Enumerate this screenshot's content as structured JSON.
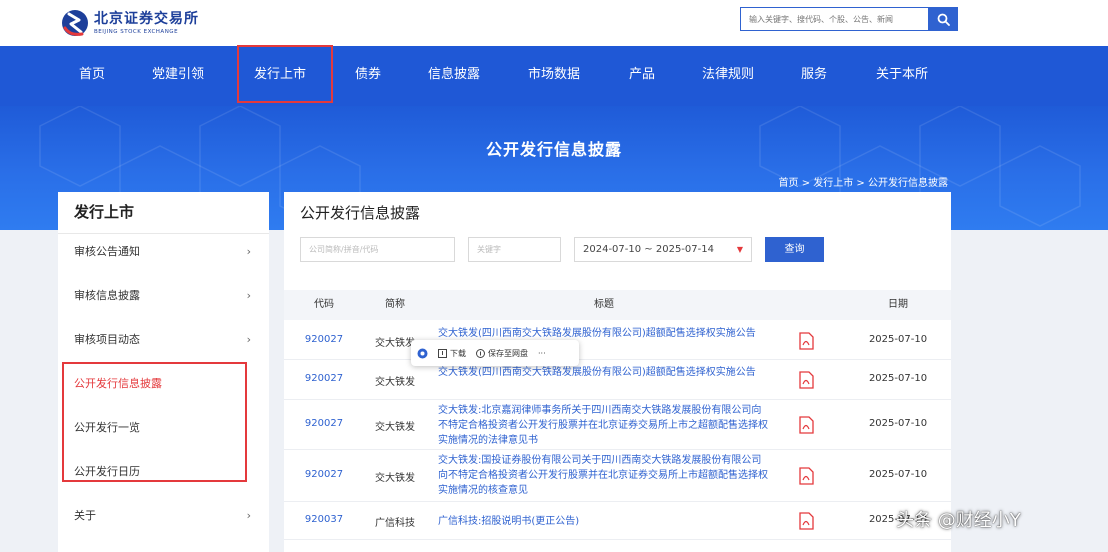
{
  "header": {
    "logo_cn": "北京证券交易所",
    "logo_en": "BEIJING STOCK EXCHANGE",
    "search_placeholder": "输入关键字、搜代码、个股、公告、新闻",
    "colors": {
      "brand": "#1f58d6",
      "accent_red": "#e4393c"
    }
  },
  "nav": {
    "items": [
      "首页",
      "党建引领",
      "发行上市",
      "债券",
      "信息披露",
      "市场数据",
      "产品",
      "法律规则",
      "服务",
      "关于本所"
    ],
    "highlighted": "发行上市"
  },
  "banner": {
    "title": "公开发行信息披露",
    "breadcrumb": "首页 > 发行上市 > 公开发行信息披露"
  },
  "sidebar": {
    "title": "发行上市",
    "items": [
      {
        "label": "审核公告通知",
        "chevron": "›"
      },
      {
        "label": "审核信息披露",
        "chevron": "›"
      },
      {
        "label": "审核项目动态",
        "chevron": "›"
      },
      {
        "label": "公开发行信息披露",
        "chevron": ""
      },
      {
        "label": "公开发行一览",
        "chevron": ""
      },
      {
        "label": "公开发行日历",
        "chevron": ""
      },
      {
        "label": "关于",
        "chevron": "›"
      }
    ]
  },
  "main": {
    "title": "公开发行信息披露",
    "filters": {
      "company_placeholder": "公司简称/拼音/代码",
      "keyword_placeholder": "关键字",
      "date_range": "2024-07-10 ~ 2025-07-14",
      "query_button": "查询"
    },
    "table": {
      "headers": [
        "代码",
        "简称",
        "标题",
        "日期"
      ],
      "rows": [
        {
          "code": "920027",
          "name": "交大铁发",
          "title": "交大铁发(四川西南交大铁路发展股份有限公司)超额配售选择权实施公告",
          "date": "2025-07-10"
        },
        {
          "code": "920027",
          "name": "交大铁发",
          "title": "交大铁发(四川西南交大铁路发展股份有限公司)超额配售选择权实施公告",
          "date": "2025-07-10"
        },
        {
          "code": "920027",
          "name": "交大铁发",
          "title": "交大铁发:北京嘉润律师事务所关于四川西南交大铁路发展股份有限公司向不特定合格投资者公开发行股票并在北京证券交易所上市之超额配售选择权实施情况的法律意见书",
          "date": "2025-07-10"
        },
        {
          "code": "920027",
          "name": "交大铁发",
          "title": "交大铁发:国投证券股份有限公司关于四川西南交大铁路发展股份有限公司向不特定合格投资者公开发行股票并在北京证券交易所上市超额配售选择权实施情况的核查意见",
          "date": "2025-07-10"
        },
        {
          "code": "920037",
          "name": "广信科技",
          "title": "广信科技:招股说明书(更正公告)",
          "date": "2025-07-10"
        }
      ]
    }
  },
  "popup": {
    "download": "下载",
    "save": "保存至网盘",
    "more": "···"
  },
  "watermark": "头条 @财经小Y"
}
